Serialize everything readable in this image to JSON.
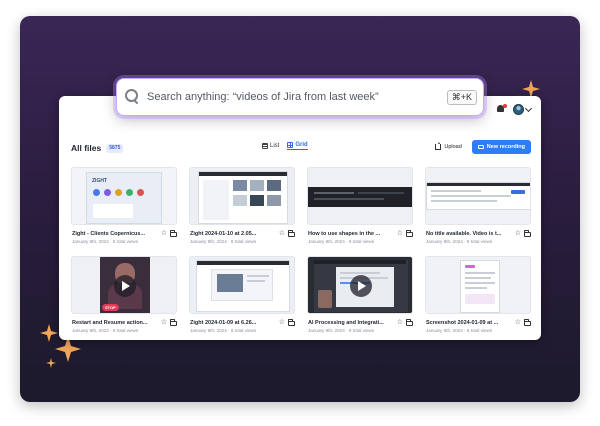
{
  "search": {
    "placeholder": "Search anything: “videos of Jira from last week”",
    "shortcut": "⌘+K"
  },
  "toolbar": {
    "title": "All files",
    "count": "5875",
    "view_list": "List",
    "view_grid": "Grid",
    "upload_label": "Upload",
    "new_recording_label": "New recording"
  },
  "files": [
    {
      "title": "Zight - Clients Copernicus...",
      "date": "January 9th, 2024",
      "views": "8 total views"
    },
    {
      "title": "Zight 2024-01-10 at 2.05...",
      "date": "January 9th, 2024",
      "views": "8 total views"
    },
    {
      "title": "How to use shapes in the ...",
      "date": "January 9th, 2024",
      "views": "8 total views"
    },
    {
      "title": "No title available. Video is t...",
      "date": "January 9th, 2024",
      "views": "8 total views"
    },
    {
      "title": "Restart and Resume action...",
      "date": "January 9th, 2024",
      "views": "8 total views"
    },
    {
      "title": "Zight 2024-01-09 at 6.26...",
      "date": "January 9th, 2024",
      "views": "8 total views"
    },
    {
      "title": "AI Processing and Integrati...",
      "date": "January 9th, 2024",
      "views": "8 total views"
    },
    {
      "title": "Screenshot 2024-01-09 at ...",
      "date": "January 9th, 2024",
      "views": "8 total views"
    }
  ],
  "thumb_text": {
    "zight_logo": "ZIGHT",
    "stop_label": "STOP"
  },
  "colors": {
    "accent": "#2f7df6",
    "background_top": "#3b2655",
    "background_bottom": "#1c1a2b",
    "sparkle": "#f2a65a"
  },
  "icons": [
    "search-icon",
    "bell-icon",
    "avatar",
    "list-icon",
    "grid-icon",
    "upload-icon",
    "camera-icon",
    "star-icon",
    "folder-icon",
    "play-icon"
  ]
}
